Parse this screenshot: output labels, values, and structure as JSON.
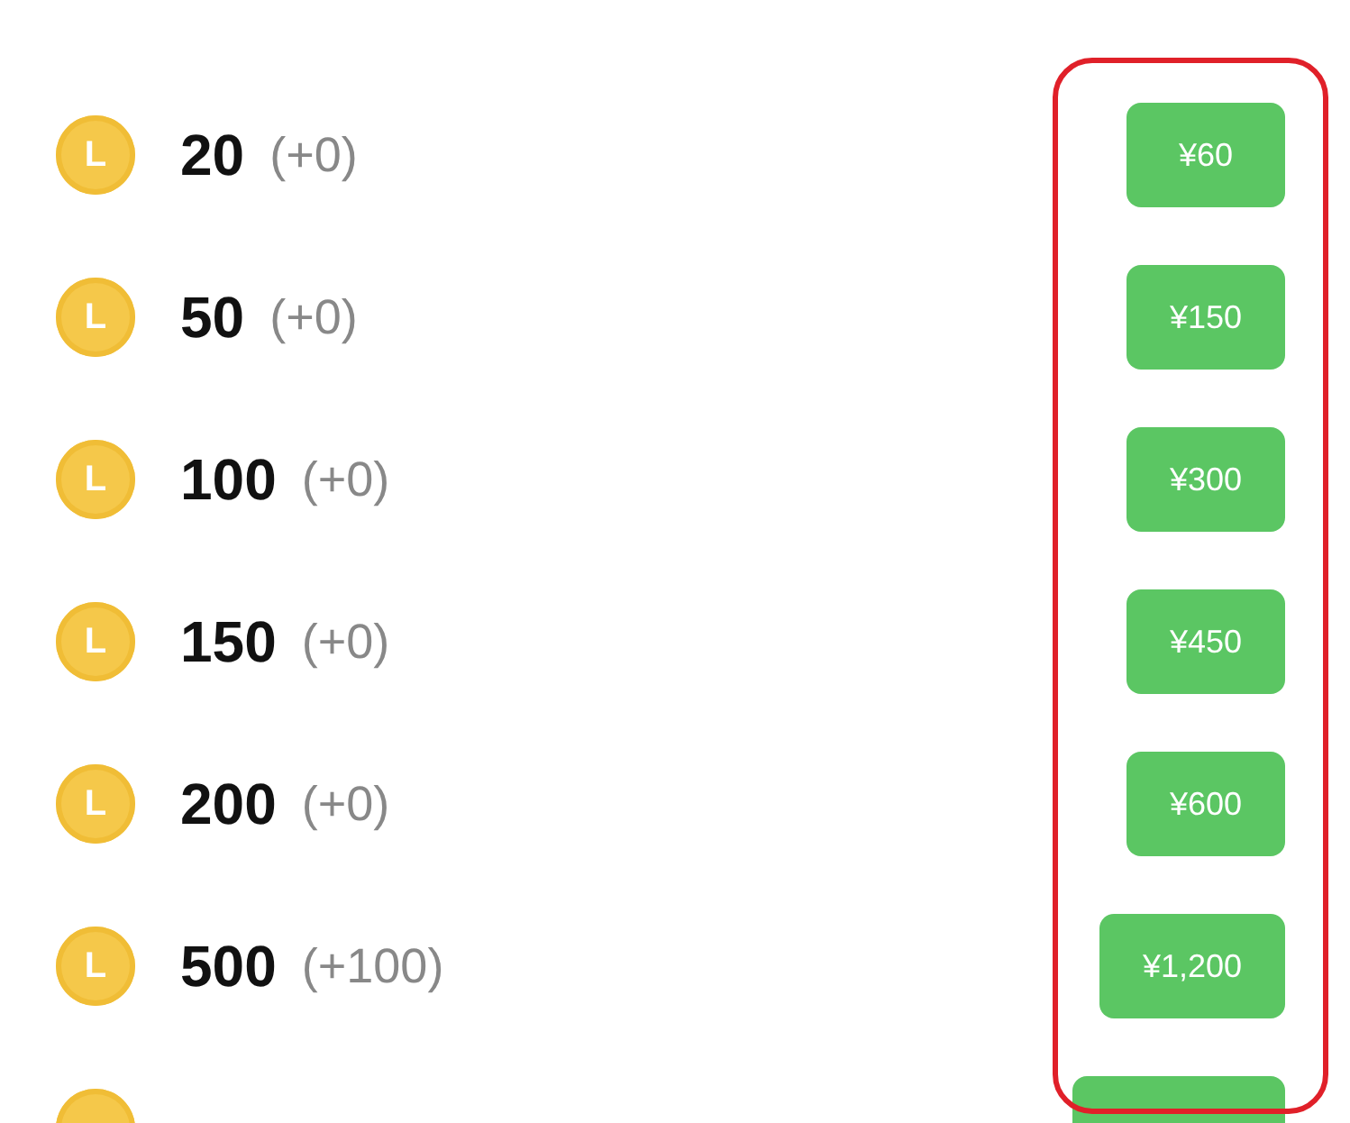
{
  "packages": [
    {
      "coin": "L",
      "amount": "20",
      "bonus": "(+0)",
      "price": "¥60"
    },
    {
      "coin": "L",
      "amount": "50",
      "bonus": "(+0)",
      "price": "¥150"
    },
    {
      "coin": "L",
      "amount": "100",
      "bonus": "(+0)",
      "price": "¥300"
    },
    {
      "coin": "L",
      "amount": "150",
      "bonus": "(+0)",
      "price": "¥450"
    },
    {
      "coin": "L",
      "amount": "200",
      "bonus": "(+0)",
      "price": "¥600"
    },
    {
      "coin": "L",
      "amount": "500",
      "bonus": "(+100)",
      "price": "¥1,200"
    },
    {
      "cut_off": true
    }
  ],
  "highlight": {
    "shown": true
  }
}
